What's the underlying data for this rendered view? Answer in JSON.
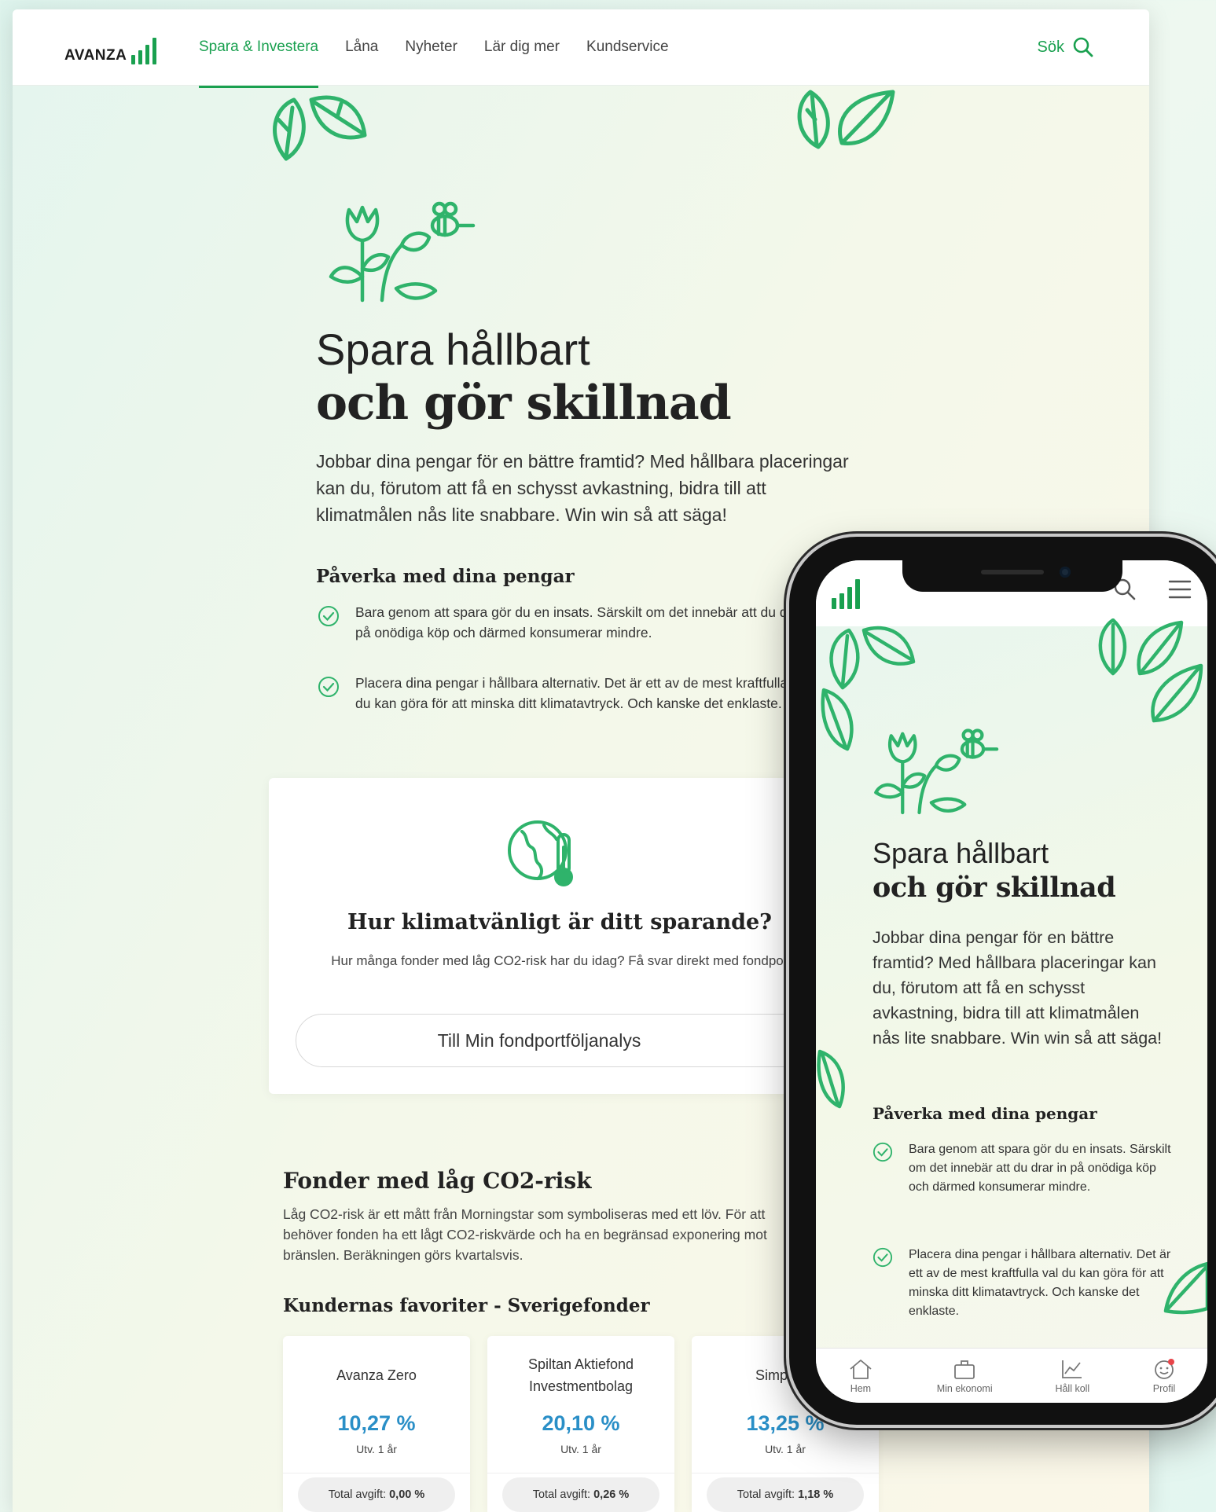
{
  "desktop": {
    "logo": "AVANZA",
    "nav": [
      {
        "label": "Spara & Investera",
        "active": true
      },
      {
        "label": "Låna"
      },
      {
        "label": "Nyheter"
      },
      {
        "label": "Lär dig mer"
      },
      {
        "label": "Kundservice"
      }
    ],
    "search_label": "Sök",
    "hero": {
      "title_line1": "Spara hållbart",
      "title_line2": "och gör skillnad",
      "intro": "Jobbar dina pengar för en bättre framtid? Med hållbara placeringar kan du, förutom att få en schysst avkastning, bidra till att klimatmålen nås lite snabbare. Win win så att säga!"
    },
    "impact": {
      "title": "Påverka med dina pengar",
      "bullets": [
        "Bara genom att spara gör du en insats. Särskilt om det innebär att du drar in på onödiga köp och därmed konsumerar mindre.",
        "Placera dina pengar i hållbara alternativ. Det är ett av de mest kraftfulla val du kan göra för att minska ditt klimatavtryck. Och kanske det enklaste."
      ]
    },
    "climate_card": {
      "title": "Hur klimatvänligt är ditt sparande?",
      "text": "Hur många fonder med låg CO2-risk har du idag? Få svar direkt med fondportföljanalys.",
      "button": "Till Min fondportföljanalys"
    },
    "low_co2": {
      "title": "Fonder med låg CO2-risk",
      "text": "Låg CO2-risk är ett mått från Morningstar som symboliseras med ett löv. För att behöver fonden ha ett lågt CO2-riskvärde och ha en begränsad exponering mot bränslen. Beräkningen görs kvartalsvis."
    },
    "favorites": {
      "title": "Kundernas favoriter - Sverigefonder",
      "funds": [
        {
          "name": "Avanza Zero",
          "return": "10,27 %",
          "period": "Utv. 1 år",
          "fee_label": "Total avgift:",
          "fee": "0,00 %"
        },
        {
          "name": "Spiltan Aktiefond Investmentbolag",
          "return": "20,10 %",
          "period": "Utv. 1 år",
          "fee_label": "Total avgift:",
          "fee": "0,26 %"
        },
        {
          "name": "Simplicity",
          "return": "13,25 %",
          "period": "Utv. 1 år",
          "fee_label": "Total avgift:",
          "fee": "1,18 %"
        }
      ]
    }
  },
  "phone": {
    "hero": {
      "title_line1": "Spara hållbart",
      "title_line2": "och gör skillnad",
      "intro": "Jobbar dina pengar för en bättre framtid? Med hållbara placeringar kan du, förutom att få en schysst avkastning, bidra till att klimatmålen nås lite snabbare. Win win så att säga!"
    },
    "impact": {
      "title": "Påverka med dina pengar",
      "bullets": [
        "Bara genom att spara gör du en insats. Särskilt om det innebär att du drar in på onödiga köp och därmed konsumerar mindre.",
        "Placera dina pengar i hållbara alternativ. Det är ett av de mest kraftfulla val du kan göra för att minska ditt klimatavtryck. Och kanske det enklaste."
      ]
    },
    "tabs": [
      {
        "label": "Hem",
        "icon": "home-icon"
      },
      {
        "label": "Min ekonomi",
        "icon": "briefcase-icon"
      },
      {
        "label": "Håll koll",
        "icon": "chart-icon"
      },
      {
        "label": "Profil",
        "icon": "profile-icon"
      }
    ]
  },
  "colors": {
    "brand_green": "#19a04f",
    "leaf_green": "#2fb36b",
    "return_blue": "#2a8fc7"
  }
}
